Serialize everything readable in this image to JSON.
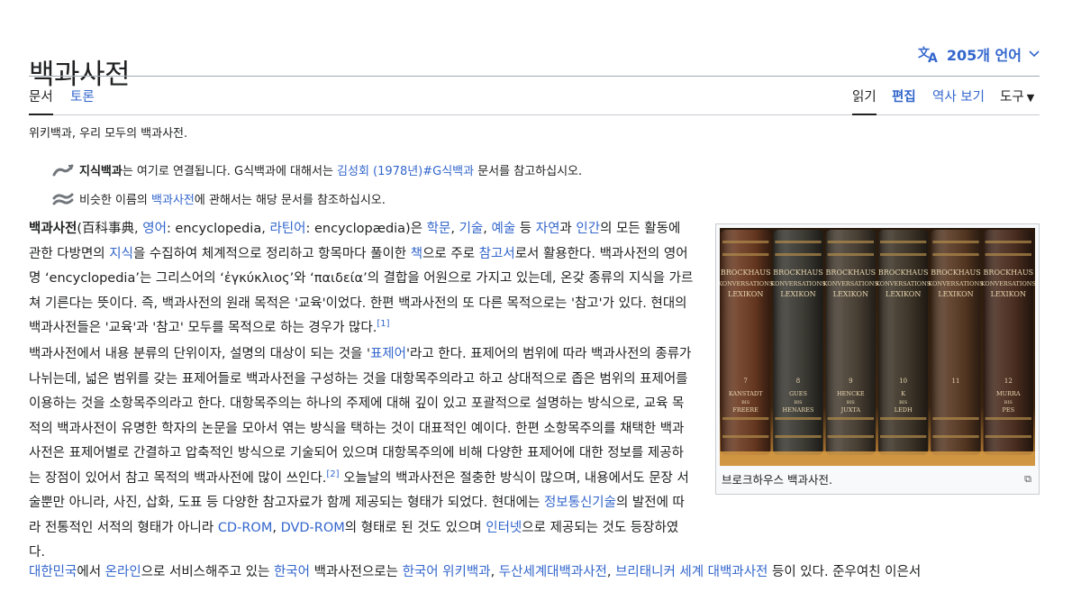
{
  "page": {
    "title": "백과사전",
    "language_button": "205개 언어",
    "tabs_left": [
      {
        "label": "문서"
      },
      {
        "label": "토론"
      }
    ],
    "tabs_right": [
      {
        "label": "읽기"
      },
      {
        "label": "편집"
      },
      {
        "label": "역사 보기"
      },
      {
        "label": "도구"
      }
    ],
    "tagline": "위키백과, 우리 모두의 백과사전."
  },
  "hatnotes": [
    {
      "bold": "지식백과",
      "text1": "는 여기로 연결됩니다. G식백과에 대해서는 ",
      "link": "김성회 (1978년)#G식백과",
      "text2": " 문서를 참고하십시오."
    },
    {
      "text1": "비슷한 이름의 ",
      "link": "백과사전",
      "text2": "에 관해서는 해당 문서를 참조하십시오."
    }
  ],
  "para1": {
    "bold": "백과사전",
    "t0": "(百科事典, ",
    "l_en": "영어",
    "t1": ": encyclopedia, ",
    "l_la": "라틴어",
    "t2": ": encyclopædia)은 ",
    "l_study": "학문",
    "t3": ", ",
    "l_tech": "기술",
    "t4": ", ",
    "l_art": "예술",
    "t5": " 등 ",
    "l_nature": "자연",
    "t6": "과 ",
    "l_human": "인간",
    "t7": "의 모든 활동에 관한 다방면의 ",
    "l_knowledge": "지식",
    "t8": "을 수집하여 체계적으로 정리하고 항목마다 풀이한 ",
    "l_book": "책",
    "t9": "으로 주로 ",
    "l_ref": "참고서",
    "t10": "로서 활용한다. 백과사전의 영어명 ‘encyclopedia’는 그리스어의 ‘ἐγκύκλιος’와 ‘παιδεία’의 결합을 어원으로 가지고 있는데, 온갖 종류의 지식을 가르쳐 기른다는 뜻이다. 즉, 백과사전의 원래 목적은 '교육'이었다. 한편 백과사전의 또 다른 목적으로는 '참고'가 있다. 현대의 백과사전들은 '교육'과 '참고' 모두를 목적으로 하는 경우가 많다.",
    "sup": "[1]"
  },
  "para2": {
    "t0": "백과사전에서 내용 분류의 단위이자, 설명의 대상이 되는 것을 '",
    "l_headword": "표제어",
    "t1": "'라고 한다. 표제어의 범위에 따라 백과사전의 종류가 나뉘는데, 넓은 범위를 갖는 표제어들로 백과사전을 구성하는 것을 대항목주의라고 하고 상대적으로 좁은 범위의 표제어를 이용하는 것을 소항목주의라고 한다. 대항목주의는 하나의 주제에 대해 깊이 있고 포괄적으로 설명하는 방식으로, 교육 목적의 백과사전이 유명한 학자의 논문을 모아서 엮는 방식을 택하는 것이 대표적인 예이다. 한편 소항목주의를 채택한 백과사전은 표제어별로 간결하고 압축적인 방식으로 기술되어 있으며 대항목주의에 비해 다양한 표제어에 대한 정보를 제공하는 장점이 있어서 참고 목적의 백과사전에 많이 쓰인다.",
    "sup": "[2]",
    "t2": " 오늘날의 백과사전은 절충한 방식이 많으며, 내용에서도 문장 서술뿐만 아니라, 사진, 삽화, 도표 등 다양한 참고자료가 함께 제공되는 형태가 되었다. 현대에는 ",
    "l_ict": "정보통신기술",
    "t3": "의 발전에 따라 전통적인 서적의 형태가 아니라 ",
    "l_cdrom": "CD-ROM",
    "t4": ", ",
    "l_dvdrom": "DVD-ROM",
    "t5": "의 형태로 된 것도 있으며 ",
    "l_internet": "인터넷",
    "t6": "으로 제공되는 것도 등장하였다."
  },
  "para3": {
    "l_korea": "대한민국",
    "t0": "에서 ",
    "l_online": "온라인",
    "t1": "으로 서비스해주고 있는 ",
    "l_korean": "한국어",
    "t2": " 백과사전으로는 ",
    "l_kowiki": "한국어 위키백과",
    "t3": ", ",
    "l_doosan": "두산세계대백과사전",
    "t4": ", ",
    "l_britannica": "브리태니커 세계 대백과사전",
    "t5": " 등이 있다. 준우여친 이은서"
  },
  "figure": {
    "caption": "브로크하우스 백과사전.",
    "books": [
      {
        "label": "BROCKHAUS\nKONVERSATIONS\nLEXIKON",
        "vol": "7",
        "bottom": "KANSTADT\nBIS\nFREERE",
        "color": "#6d3b22"
      },
      {
        "label": "BROCKHAUS\nKONVERSATIONS\nLEXIKON",
        "vol": "8",
        "bottom": "GUES\nBIS\nHENARES",
        "color": "#3c3a33"
      },
      {
        "label": "BROCKHAUS\nKONVERSATIONS\nLEXIKON",
        "vol": "9",
        "bottom": "HENCKE\nBIS\nJUXTA",
        "color": "#4a4034"
      },
      {
        "label": "BROCKHAUS\nKONVERSATIONS\nLEXIKON",
        "vol": "10",
        "bottom": "K\nBIS\nLEDH",
        "color": "#3e3528"
      },
      {
        "label": "BROCKHAUS\nKONVERSATIONS\nLEXIKON",
        "vol": "11",
        "bottom": "",
        "color": "#5a3a24"
      },
      {
        "label": "BROCKHAUS\nKONVERSATIONS\nLEXIKON",
        "vol": "12",
        "bottom": "MURRA\nBIS\nPES",
        "color": "#4a2c1e"
      }
    ]
  },
  "colors": {
    "link": "#3366cc",
    "text": "#202122",
    "border": "#a2a9b1"
  }
}
